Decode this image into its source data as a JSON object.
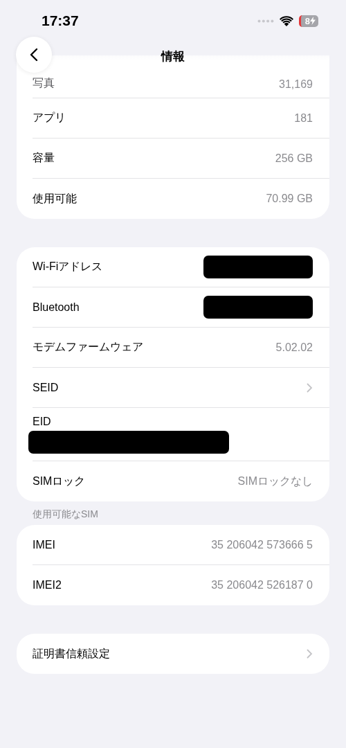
{
  "status_bar": {
    "time": "17:37",
    "battery_text": "8"
  },
  "nav": {
    "title": "情報"
  },
  "groups": [
    {
      "rows": [
        {
          "kind": "value",
          "label": "写真",
          "value": "31,169",
          "faded": true
        },
        {
          "kind": "value",
          "label": "アプリ",
          "value": "181",
          "faded": false
        },
        {
          "kind": "value",
          "label": "容量",
          "value": "256 GB",
          "faded": false
        },
        {
          "kind": "value",
          "label": "使用可能",
          "value": "70.99 GB",
          "faded": false
        }
      ]
    },
    {
      "rows": [
        {
          "kind": "redacted",
          "label": "Wi-Fiアドレス"
        },
        {
          "kind": "redacted",
          "label": "Bluetooth"
        },
        {
          "kind": "value",
          "label": "モデムファームウェア",
          "value": "5.02.02",
          "faded": false
        },
        {
          "kind": "chevron",
          "label": "SEID"
        },
        {
          "kind": "redacted_below",
          "label": "EID"
        },
        {
          "kind": "value",
          "label": "SIMロック",
          "value": "SIMロックなし",
          "faded": false
        }
      ]
    },
    {
      "header": "使用可能なSIM",
      "rows": [
        {
          "kind": "value",
          "label": "IMEI",
          "value": "35 206042 573666 5",
          "faded": false
        },
        {
          "kind": "value",
          "label": "IMEI2",
          "value": "35 206042 526187 0",
          "faded": false
        }
      ]
    },
    {
      "rows": [
        {
          "kind": "chevron",
          "label": "証明書信頼設定"
        }
      ]
    }
  ]
}
